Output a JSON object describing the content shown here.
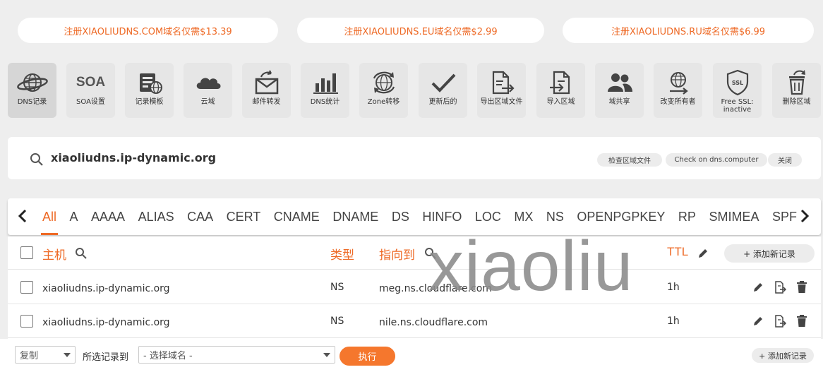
{
  "promos": [
    "注册XIAOLIUDNS.COM域名仅需$13.39",
    "注册XIAOLIUDNS.EU域名仅需$2.99",
    "注册XIAOLIUDNS.RU域名仅需$6.99"
  ],
  "toolbar": {
    "dns_records": "DNS记录",
    "soa_glyph": "SOA",
    "soa_settings": "SOA设置",
    "record_templates": "记录模板",
    "cloud": "云域",
    "mail_forward": "邮件转发",
    "dns_stats": "DNS统计",
    "zone_transfer": "Zone转移",
    "updated": "更新后的",
    "export_zone": "导出区域文件",
    "import_zone": "导入区域",
    "share_domain": "域共享",
    "change_owner": "改变所有者",
    "free_ssl": "Free SSL: inactive",
    "delete_zone": "删除区域"
  },
  "search": {
    "domain": "xiaoliudns.ip-dynamic.org",
    "check_zone": "检查区域文件",
    "check_dns": "Check on dns.computer",
    "close": "关闭"
  },
  "tabs": [
    "All",
    "A",
    "AAAA",
    "ALIAS",
    "CAA",
    "CERT",
    "CNAME",
    "DNAME",
    "DS",
    "HINFO",
    "LOC",
    "MX",
    "NS",
    "OPENPGPKEY",
    "RP",
    "SMIMEA",
    "SPF"
  ],
  "active_tab": "All",
  "table": {
    "headers": {
      "host": "主机",
      "type": "类型",
      "points_to": "指向到",
      "ttl": "TTL"
    },
    "add_record": "+ 添加新记录",
    "rows": [
      {
        "host": "xiaoliudns.ip-dynamic.org",
        "type": "NS",
        "value": "meg.ns.cloudflare.com",
        "ttl": "1h"
      },
      {
        "host": "xiaoliudns.ip-dynamic.org",
        "type": "NS",
        "value": "nile.ns.cloudflare.com",
        "ttl": "1h"
      }
    ]
  },
  "watermark": "xiaoliu",
  "bottom": {
    "copy_value": "复制",
    "move_label": "所选记录到",
    "domain_placeholder": "- 选择域名 -",
    "execute": "执行",
    "add_record": "+ 添加新记录"
  },
  "colors": {
    "accent": "#ee6a26",
    "button": "#f5772d"
  }
}
